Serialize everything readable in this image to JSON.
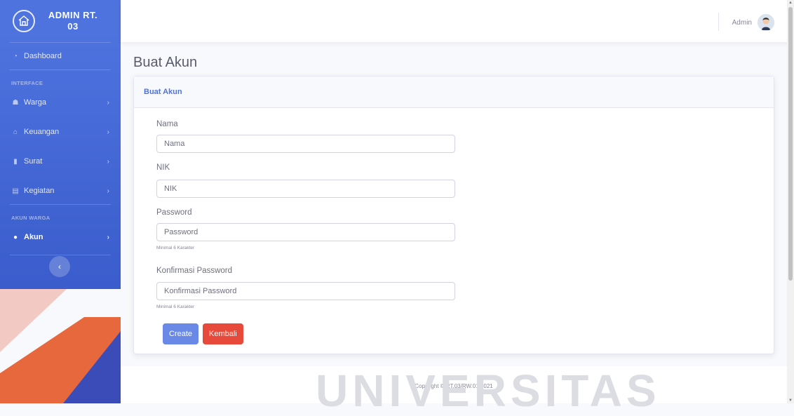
{
  "brand": {
    "name": "ADMIN RT. 03",
    "icon": "house-icon"
  },
  "sidebar": {
    "dashboard": {
      "label": "Dashboard",
      "icon": "dashboard-icon"
    },
    "heading_interface": "INTERFACE",
    "items": [
      {
        "label": "Warga",
        "icon": "users-icon"
      },
      {
        "label": "Keuangan",
        "icon": "bank-icon"
      },
      {
        "label": "Surat",
        "icon": "file-icon"
      },
      {
        "label": "Kegiatan",
        "icon": "calendar-icon"
      }
    ],
    "heading_akun": "AKUN WARGA",
    "akun": {
      "label": "Akun",
      "icon": "user-circle-icon",
      "active": true
    },
    "toggle_icon": "chevron-left-icon"
  },
  "topbar": {
    "user_name": "Admin"
  },
  "page": {
    "title": "Buat Akun"
  },
  "card": {
    "header": "Buat Akun",
    "fields": {
      "nama": {
        "label": "Nama",
        "placeholder": "Nama"
      },
      "nik": {
        "label": "NIK",
        "placeholder": "NIK"
      },
      "password": {
        "label": "Password",
        "placeholder": "Password",
        "help": "Minimal 6 Karakter"
      },
      "konfirmasi": {
        "label": "Konfirmasi Password",
        "placeholder": "Konfirmasi Password",
        "help": "Minimal 6 Karakter"
      }
    },
    "buttons": {
      "create": "Create",
      "kembali": "Kembali"
    }
  },
  "footer": {
    "copyright": "Copyright © RT.03/RW.01 2021"
  },
  "colors": {
    "primary": "#4e73df",
    "danger": "#e74a3b",
    "page_bg": "#f8f9fc"
  },
  "watermark": "UNIVERSITAS"
}
